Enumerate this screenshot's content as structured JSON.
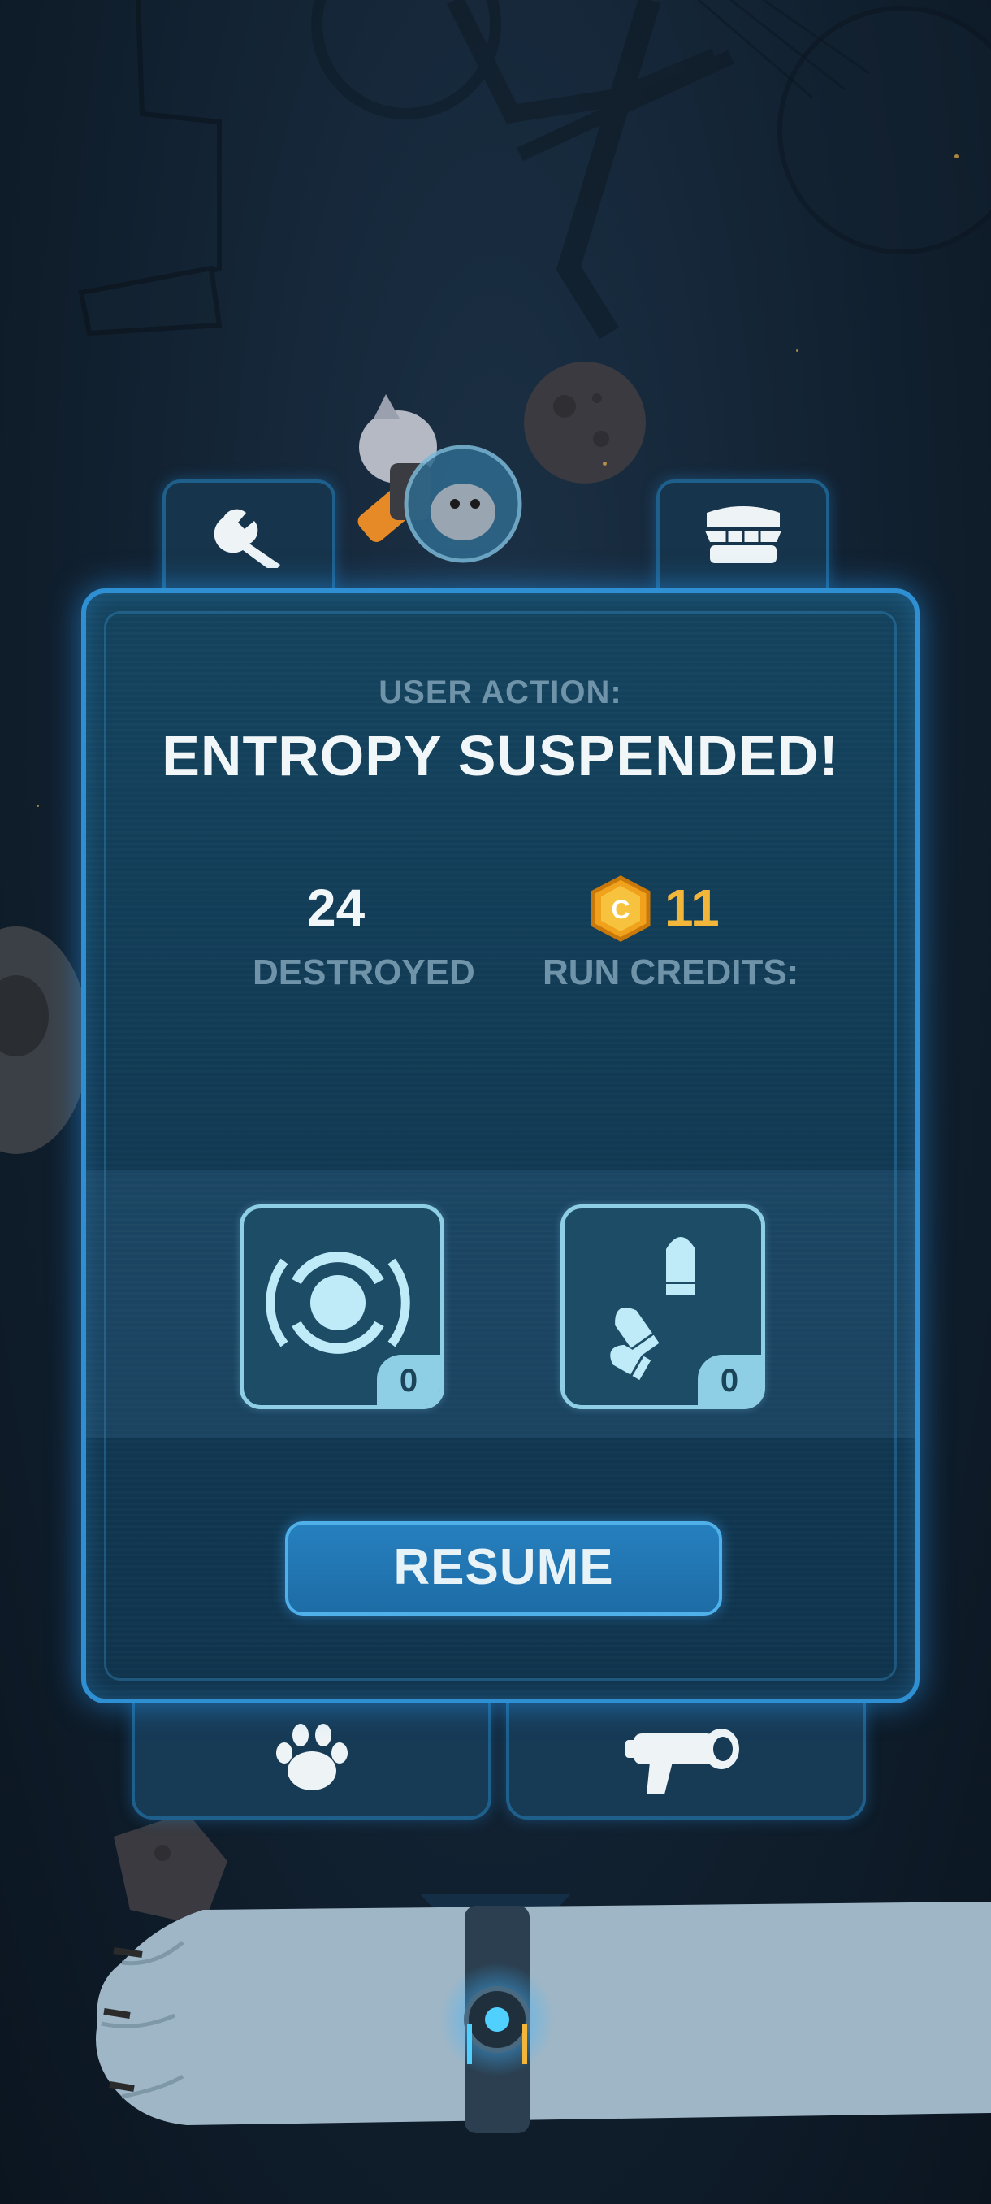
{
  "header": {
    "subtitle": "USER ACTION:",
    "title": "ENTROPY SUSPENDED!"
  },
  "stats": {
    "destroyed_value": "24",
    "destroyed_label": "DESTROYED",
    "credits_value": "11",
    "credits_label": "RUN CREDITS:",
    "credits_coin_letter": "C"
  },
  "items": [
    {
      "name": "shield",
      "icon": "shield-ring-icon",
      "count": "0"
    },
    {
      "name": "ammo",
      "icon": "bullets-icon",
      "count": "0"
    }
  ],
  "resume_label": "RESUME",
  "tabs": {
    "top": [
      "wrench-icon",
      "shop-icon"
    ],
    "bottom": [
      "paw-icon",
      "blaster-icon"
    ]
  },
  "colors": {
    "panel_border": "#2f8fd3",
    "coin": "#f0a21c",
    "credits_text": "#f2b63a",
    "label_text": "#6f93a8"
  }
}
